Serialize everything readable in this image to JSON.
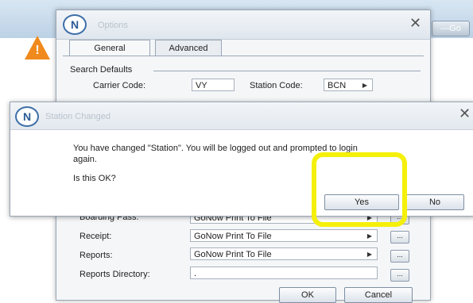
{
  "background": {
    "button_label": "—Go"
  },
  "options": {
    "title": "Options",
    "tabs": [
      {
        "label": "General",
        "active": true
      },
      {
        "label": "Advanced",
        "active": false
      }
    ],
    "search_defaults": {
      "section_label": "Search Defaults",
      "carrier_label": "Carrier Code:",
      "carrier_value": "VY",
      "station_label": "Station Code:",
      "station_value": "BCN"
    },
    "printers": [
      {
        "label": "Boarding Pass:",
        "value": "GoNow Print To File"
      },
      {
        "label": "Receipt:",
        "value": "GoNow Print To File"
      },
      {
        "label": "Reports:",
        "value": "GoNow Print To File"
      }
    ],
    "reports_directory": {
      "label": "Reports Directory:",
      "value": "."
    },
    "browse_label": "...",
    "ok_label": "OK",
    "cancel_label": "Cancel"
  },
  "dialog": {
    "title": "Station Changed",
    "message_line1": "You have changed \"Station\".  You will be logged out and prompted to login",
    "message_line2": "again.",
    "question": "Is this OK?",
    "yes_label": "Yes",
    "no_label": "No"
  },
  "colors": {
    "highlight": "#f5f00a",
    "warning_icon": "#f08a1c",
    "logo": "#3e6fa8"
  }
}
